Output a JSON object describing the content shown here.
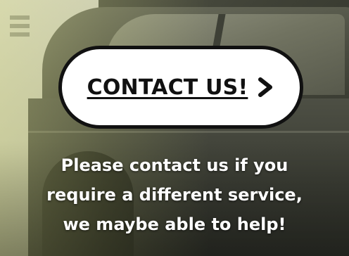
{
  "cta": {
    "label": "CONTACT US!",
    "icon": "chevron-right-icon"
  },
  "message": {
    "lines": [
      "Please contact us if you",
      "require a different service,",
      "we maybe able to help!"
    ]
  },
  "colors": {
    "cta_background": "#ffffff",
    "cta_border": "#111111",
    "text": "#ffffff"
  }
}
